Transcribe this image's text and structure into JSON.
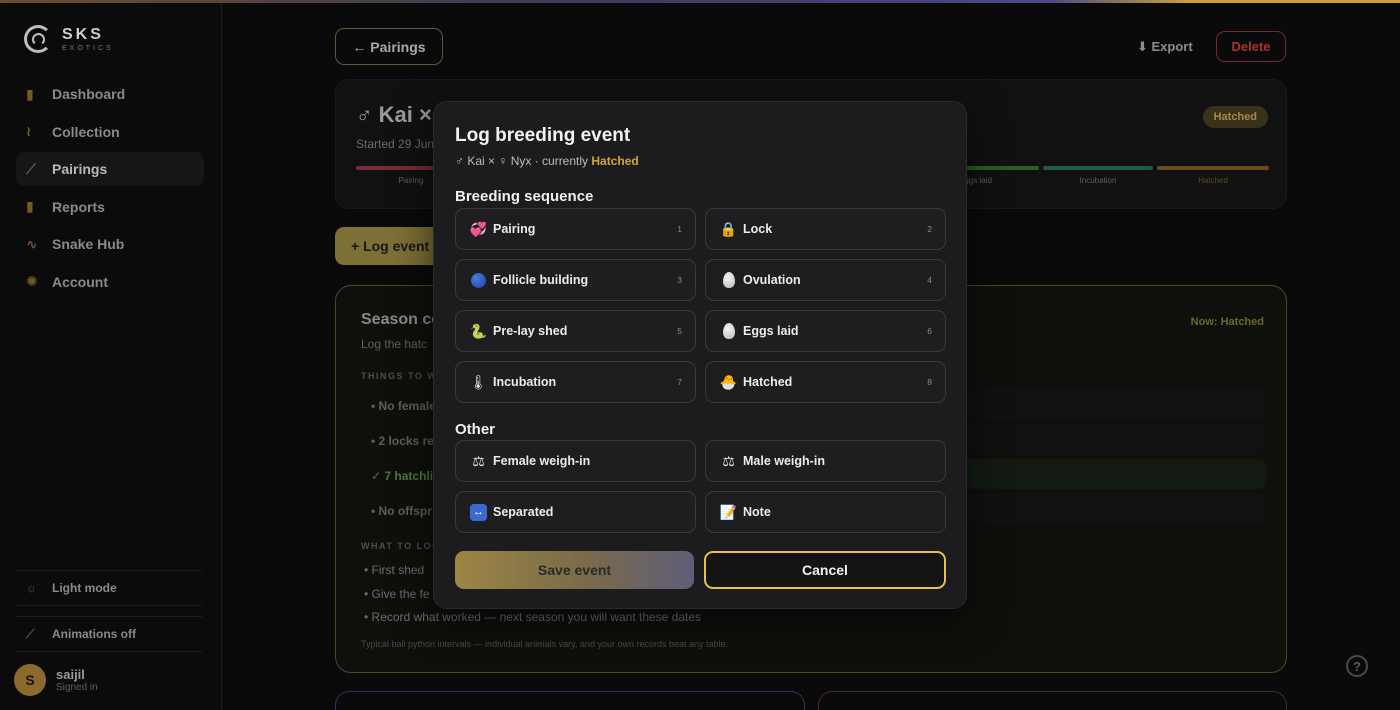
{
  "brand": {
    "name": "SKS",
    "sub": "EXOTICS"
  },
  "sidebar": {
    "items": [
      {
        "label": "Dashboard",
        "icon": "dashboard-icon",
        "glyph": "▮"
      },
      {
        "label": "Collection",
        "icon": "snake-icon",
        "glyph": "≀"
      },
      {
        "label": "Pairings",
        "icon": "pairings-icon",
        "glyph": "⟋"
      },
      {
        "label": "Reports",
        "icon": "reports-icon",
        "glyph": "▮"
      },
      {
        "label": "Snake Hub",
        "icon": "snake-hub-icon",
        "glyph": "∿"
      },
      {
        "label": "Account",
        "icon": "account-gear-icon",
        "glyph": "✺"
      }
    ],
    "light_mode": "Light mode",
    "animations": "Animations off",
    "user": {
      "initial": "S",
      "name": "saijil",
      "status": "Signed in"
    }
  },
  "toolbar": {
    "back_label": "← Pairings",
    "export_label": "⬇ Export",
    "delete_label": "Delete"
  },
  "pairing": {
    "title": "♂ Kai × ♀",
    "started": "Started 29 Jun",
    "status_badge": "Hatched",
    "stage_labels": [
      "Pairing",
      "Eggs laid",
      "Incubation",
      "Hatched"
    ],
    "log_event_label": "+ Log event"
  },
  "season": {
    "title": "Season co",
    "subtitle": "Log the hatc",
    "now_label": "Now: Hatched",
    "things_label": "THINGS TO W",
    "checks": [
      "• No female",
      "• 2 locks re",
      "✓ 7 hatchli",
      "• No offspr"
    ],
    "look_label": "WHAT TO LOO",
    "bullets": [
      "First shed",
      "Give the fe",
      "Record what worked — next season you will want these dates"
    ],
    "footnote": "Typical ball python intervals — individual animals vary, and your own records beat any table."
  },
  "modal": {
    "title": "Log breeding event",
    "subtitle_prefix": "♂ Kai × ♀ Nyx · currently ",
    "current_status": "Hatched",
    "breeding_heading": "Breeding sequence",
    "breeding_options": [
      {
        "label": "Pairing",
        "num": "1",
        "icon": "hearts-icon"
      },
      {
        "label": "Lock",
        "num": "2",
        "icon": "lock-icon"
      },
      {
        "label": "Follicle building",
        "num": "3",
        "icon": "blue-circle-icon"
      },
      {
        "label": "Ovulation",
        "num": "4",
        "icon": "egg-icon"
      },
      {
        "label": "Pre-lay shed",
        "num": "5",
        "icon": "snake-icon"
      },
      {
        "label": "Eggs laid",
        "num": "6",
        "icon": "egg-icon"
      },
      {
        "label": "Incubation",
        "num": "7",
        "icon": "thermometer-icon"
      },
      {
        "label": "Hatched",
        "num": "8",
        "icon": "hatching-chick-icon"
      }
    ],
    "other_heading": "Other",
    "other_options": [
      {
        "label": "Female weigh-in",
        "icon": "scale-icon"
      },
      {
        "label": "Male weigh-in",
        "icon": "scale-icon"
      },
      {
        "label": "Separated",
        "icon": "left-right-arrow-icon"
      },
      {
        "label": "Note",
        "icon": "memo-icon"
      }
    ],
    "save_label": "Save event",
    "cancel_label": "Cancel"
  },
  "help": {
    "label": "?"
  },
  "colors": {
    "accent": "#e6c04a",
    "status_hatched": "#d4a534",
    "danger": "#a33333"
  }
}
